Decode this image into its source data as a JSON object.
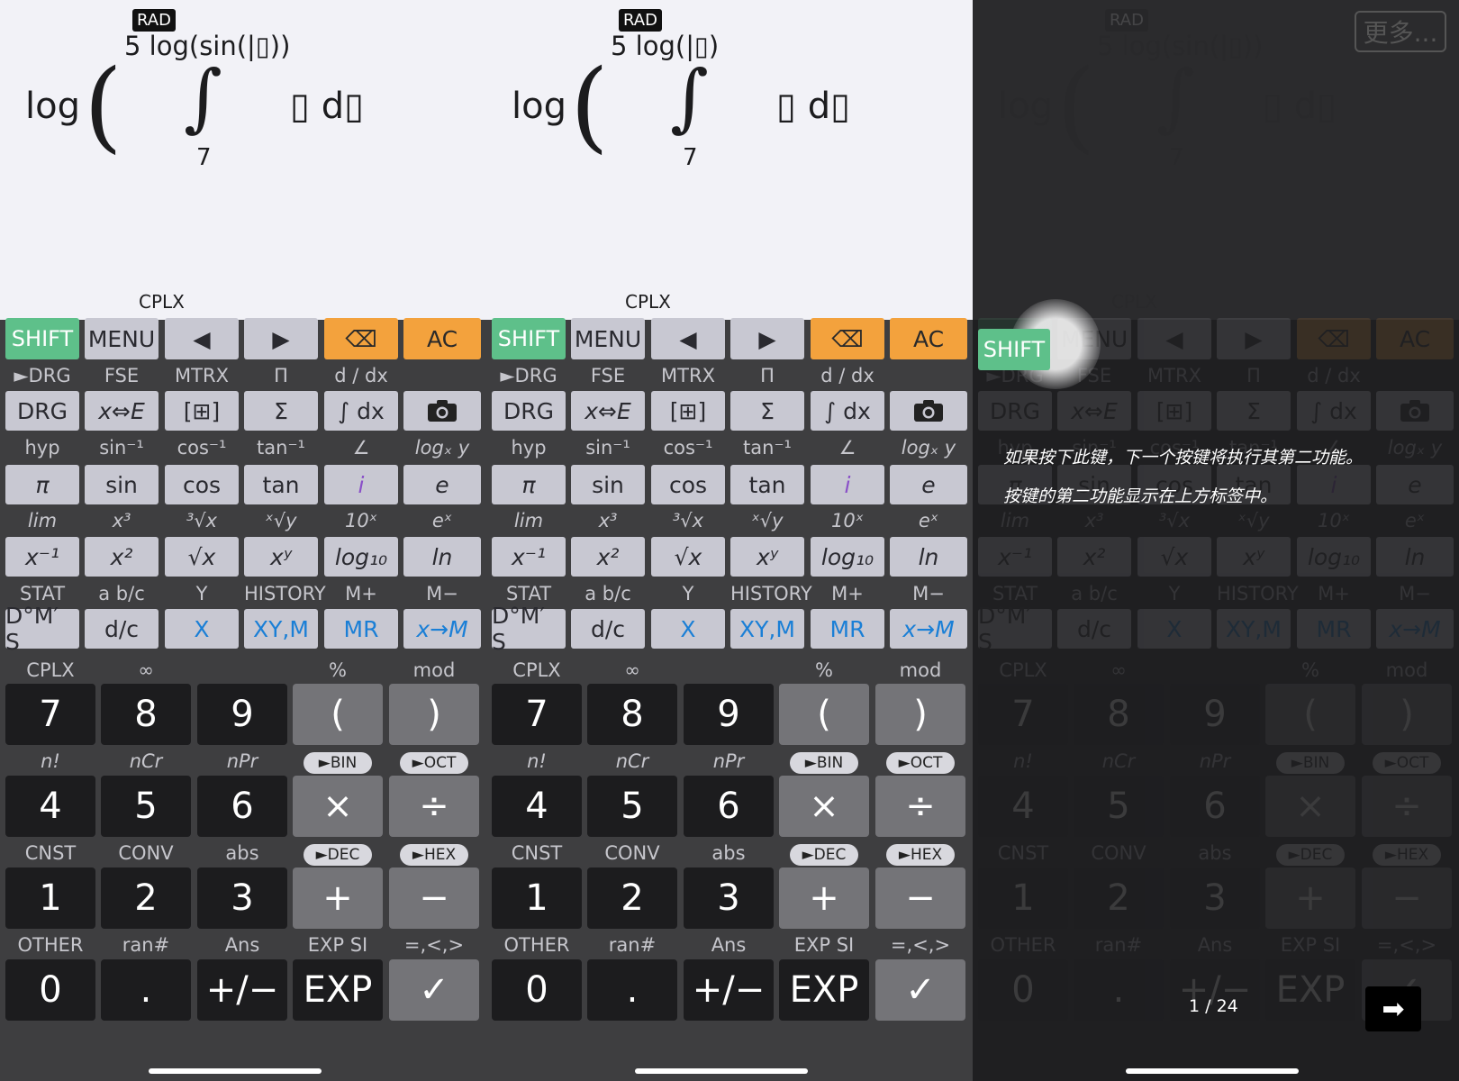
{
  "display": {
    "angle_mode": "RAD",
    "expr_left_upper": "5 log(sin(|▯))",
    "expr_right_upper": "5 log(|▯)",
    "outer_fn": "log",
    "paren": "(",
    "integral_sign": "∫",
    "lower_limit": "7",
    "integrand": "▯ d▯",
    "status": "CPLX"
  },
  "keys": {
    "row1": [
      "SHIFT",
      "MENU",
      "◀",
      "▶",
      "⌫",
      "AC"
    ],
    "row2_top": [
      "►DRG",
      "FSE",
      "MTRX",
      "Π",
      "d / dx",
      ""
    ],
    "row2": [
      "DRG",
      "x⇔E",
      "[⊞]",
      "Σ",
      "∫ dx",
      "camera"
    ],
    "row3_top": [
      "hyp",
      "sin⁻¹",
      "cos⁻¹",
      "tan⁻¹",
      "∠",
      "logₓ y"
    ],
    "row3": [
      "π",
      "sin",
      "cos",
      "tan",
      "i",
      "e"
    ],
    "row4_top": [
      "lim",
      "x³",
      "³√x",
      "ˣ√y",
      "10ˣ",
      "eˣ"
    ],
    "row4": [
      "x⁻¹",
      "x²",
      "√x",
      "xʸ",
      "log₁₀",
      "ln"
    ],
    "row5_top": [
      "STAT",
      "a b/c",
      "Y",
      "HISTORY",
      "M+",
      "M−"
    ],
    "row5": [
      "D°M′ S",
      "d/c",
      "X",
      "XY,M",
      "MR",
      "x→M"
    ],
    "num1_top": [
      "CPLX",
      "∞",
      "",
      "%",
      "mod"
    ],
    "num1": [
      "7",
      "8",
      "9",
      "(",
      ")"
    ],
    "num2_top": [
      "n!",
      "nCr",
      "nPr",
      "►BIN",
      "►OCT"
    ],
    "num2": [
      "4",
      "5",
      "6",
      "×",
      "÷"
    ],
    "num3_top": [
      "CNST",
      "CONV",
      "abs",
      "►DEC",
      "►HEX"
    ],
    "num3": [
      "1",
      "2",
      "3",
      "+",
      "−"
    ],
    "num4_top": [
      "OTHER",
      "ran#",
      "Ans",
      "EXP SI",
      "=,<,>"
    ],
    "num4": [
      "0",
      ".",
      "+/−",
      "EXP",
      "✓"
    ]
  },
  "overlay": {
    "more_label": "更多...",
    "tip_line1": "如果按下此键，下一个按键将执行其第二功能。",
    "tip_line2": "按键的第二功能显示在上方标签中。",
    "pager": "1 / 24",
    "next_icon": "➡",
    "highlighted_key": "SHIFT"
  }
}
